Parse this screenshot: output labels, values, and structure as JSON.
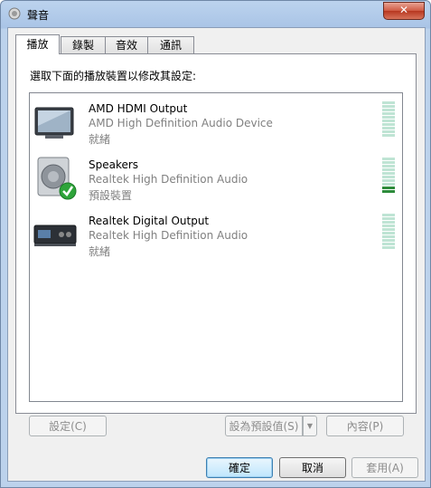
{
  "window": {
    "title": "聲音",
    "close_label": "✕"
  },
  "tabs": [
    {
      "label": "播放"
    },
    {
      "label": "錄製"
    },
    {
      "label": "音效"
    },
    {
      "label": "通訊"
    }
  ],
  "panel": {
    "instruction": "選取下面的播放裝置以修改其設定:"
  },
  "devices": [
    {
      "name": "AMD HDMI Output",
      "driver": "AMD High Definition Audio Device",
      "status": "就緒",
      "icon": "monitor-icon",
      "level_segments_active": 0
    },
    {
      "name": "Speakers",
      "driver": "Realtek High Definition Audio",
      "status": "預設裝置",
      "icon": "speaker-icon",
      "default": true,
      "level_segments_active": 2
    },
    {
      "name": "Realtek Digital Output",
      "driver": "Realtek High Definition Audio",
      "status": "就緒",
      "icon": "digital-output-icon",
      "level_segments_active": 0
    }
  ],
  "buttons": {
    "configure": "設定(C)",
    "set_default": "設為預設值(S)",
    "properties": "內容(P)",
    "ok": "確定",
    "cancel": "取消",
    "apply": "套用(A)"
  },
  "colors": {
    "title_gradient": "#bcd3ee",
    "meter_off": "#bfe4d4",
    "meter_on": "#2d8b3b",
    "close_red": "#cf5a43",
    "check_green": "#2ea43a"
  }
}
